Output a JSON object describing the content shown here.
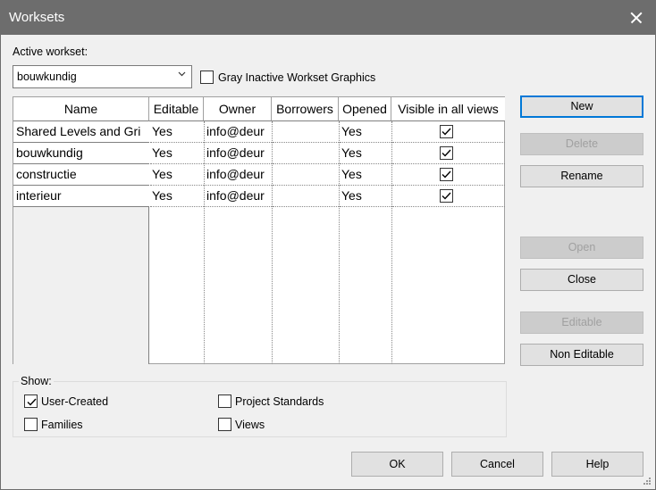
{
  "window": {
    "title": "Worksets"
  },
  "active_workset": {
    "label": "Active workset:",
    "value": "bouwkundig"
  },
  "gray_inactive": {
    "label": "Gray Inactive Workset Graphics",
    "checked": false
  },
  "table": {
    "columns": [
      "Name",
      "Editable",
      "Owner",
      "Borrowers",
      "Opened",
      "Visible in all views"
    ],
    "rows": [
      {
        "name": "Shared Levels and Gri",
        "editable": "Yes",
        "owner": "info@deur",
        "borrowers": "",
        "opened": "Yes",
        "visible": true
      },
      {
        "name": "bouwkundig",
        "editable": "Yes",
        "owner": "info@deur",
        "borrowers": "",
        "opened": "Yes",
        "visible": true
      },
      {
        "name": "constructie",
        "editable": "Yes",
        "owner": "info@deur",
        "borrowers": "",
        "opened": "Yes",
        "visible": true
      },
      {
        "name": "interieur",
        "editable": "Yes",
        "owner": "info@deur",
        "borrowers": "",
        "opened": "Yes",
        "visible": true
      }
    ]
  },
  "buttons": {
    "new": "New",
    "delete": "Delete",
    "rename": "Rename",
    "open": "Open",
    "close": "Close",
    "editable": "Editable",
    "non_editable": "Non Editable",
    "ok": "OK",
    "cancel": "Cancel",
    "help": "Help"
  },
  "show": {
    "label": "Show:",
    "user_created": {
      "label": "User-Created",
      "checked": true
    },
    "families": {
      "label": "Families",
      "checked": false
    },
    "project_standards": {
      "label": "Project Standards",
      "checked": false
    },
    "views": {
      "label": "Views",
      "checked": false
    }
  },
  "colors": {
    "titlebar": "#6d6d6d",
    "accent": "#0078d7",
    "dialog_bg": "#f0f0f0"
  }
}
